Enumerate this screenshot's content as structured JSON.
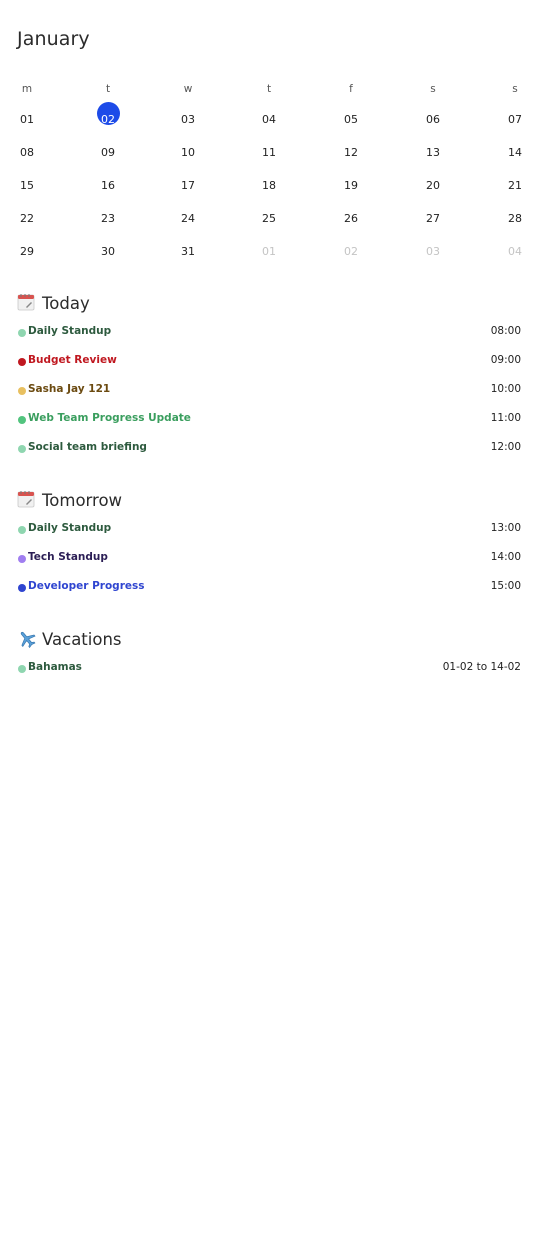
{
  "calendar": {
    "month": "January",
    "weekdays": [
      "m",
      "t",
      "w",
      "t",
      "f",
      "s",
      "s"
    ],
    "weeks": [
      [
        {
          "d": "01"
        },
        {
          "d": "02",
          "selected": true
        },
        {
          "d": "03"
        },
        {
          "d": "04"
        },
        {
          "d": "05"
        },
        {
          "d": "06"
        },
        {
          "d": "07"
        }
      ],
      [
        {
          "d": "08"
        },
        {
          "d": "09"
        },
        {
          "d": "10"
        },
        {
          "d": "11"
        },
        {
          "d": "12"
        },
        {
          "d": "13"
        },
        {
          "d": "14"
        }
      ],
      [
        {
          "d": "15"
        },
        {
          "d": "16"
        },
        {
          "d": "17"
        },
        {
          "d": "18"
        },
        {
          "d": "19"
        },
        {
          "d": "20"
        },
        {
          "d": "21"
        }
      ],
      [
        {
          "d": "22"
        },
        {
          "d": "23"
        },
        {
          "d": "24"
        },
        {
          "d": "25"
        },
        {
          "d": "26"
        },
        {
          "d": "27"
        },
        {
          "d": "28"
        }
      ],
      [
        {
          "d": "29"
        },
        {
          "d": "30"
        },
        {
          "d": "31"
        },
        {
          "d": "01",
          "muted": true
        },
        {
          "d": "02",
          "muted": true
        },
        {
          "d": "03",
          "muted": true
        },
        {
          "d": "04",
          "muted": true
        }
      ]
    ],
    "selected_color": "#1d4be8"
  },
  "sections": [
    {
      "title": "Today",
      "icon": "calendar-icon",
      "events": [
        {
          "name": "Daily Standup",
          "time": "08:00",
          "dot": "#8fd6b0",
          "text": "#2d5a3e"
        },
        {
          "name": "Budget Review",
          "time": "09:00",
          "dot": "#c01820",
          "text": "#c01820"
        },
        {
          "name": "Sasha Jay 121",
          "time": "10:00",
          "dot": "#e8c060",
          "text": "#6b4a10"
        },
        {
          "name": "Web Team Progress Update",
          "time": "11:00",
          "dot": "#52c47e",
          "text": "#3a9e5e"
        },
        {
          "name": "Social team briefing",
          "time": "12:00",
          "dot": "#8fd6b0",
          "text": "#2d5a3e"
        }
      ]
    },
    {
      "title": "Tomorrow",
      "icon": "calendar-icon",
      "events": [
        {
          "name": "Daily Standup",
          "time": "13:00",
          "dot": "#8fd6b0",
          "text": "#2d5a3e"
        },
        {
          "name": "Tech Standup",
          "time": "14:00",
          "dot": "#a07ef0",
          "text": "#2b1e55"
        },
        {
          "name": "Developer Progress",
          "time": "15:00",
          "dot": "#2f45d0",
          "text": "#2f45d0"
        }
      ]
    },
    {
      "title": "Vacations",
      "icon": "airplane-icon",
      "events": [
        {
          "name": "Bahamas",
          "time": "01-02 to 14-02",
          "dot": "#8fd6b0",
          "text": "#2d5a3e"
        }
      ]
    }
  ]
}
